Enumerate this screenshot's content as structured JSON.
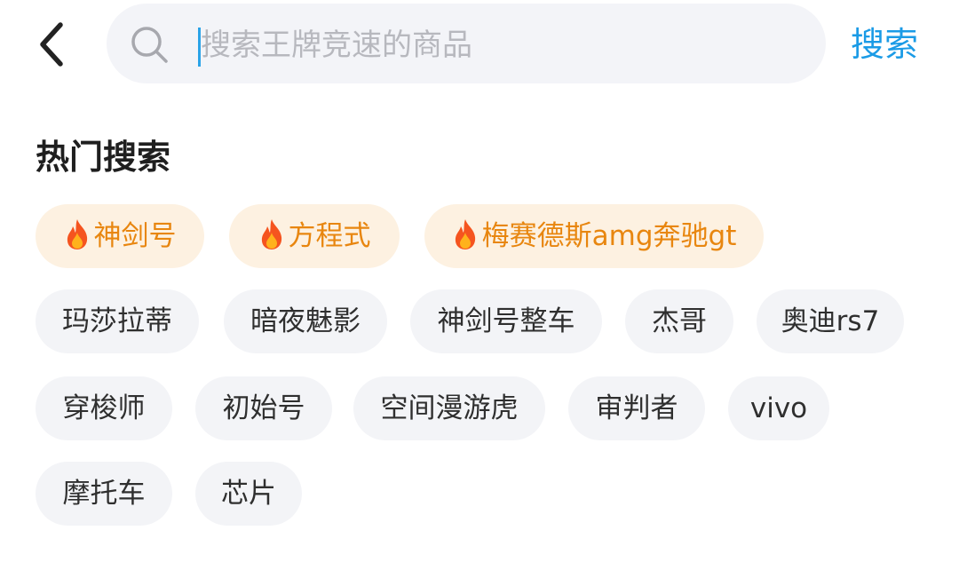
{
  "header": {
    "search_placeholder": "搜索王牌竞速的商品",
    "search_button_label": "搜索"
  },
  "hot_search": {
    "title": "热门搜索",
    "highlight_color": "#e8860f",
    "tags": [
      {
        "label": "神剑号",
        "hot": true
      },
      {
        "label": "方程式",
        "hot": true
      },
      {
        "label": "梅赛德斯amg奔驰gt",
        "hot": true
      },
      {
        "label": "玛莎拉蒂",
        "hot": false
      },
      {
        "label": "暗夜魅影",
        "hot": false
      },
      {
        "label": "神剑号整车",
        "hot": false
      },
      {
        "label": "杰哥",
        "hot": false
      },
      {
        "label": "奥迪rs7",
        "hot": false
      },
      {
        "label": "穿梭师",
        "hot": false
      },
      {
        "label": "初始号",
        "hot": false
      },
      {
        "label": "空间漫游虎",
        "hot": false
      },
      {
        "label": "审判者",
        "hot": false
      },
      {
        "label": "vivo",
        "hot": false
      },
      {
        "label": "摩托车",
        "hot": false
      },
      {
        "label": "芯片",
        "hot": false
      }
    ]
  },
  "icons": {
    "back": "chevron-left-icon",
    "search": "search-icon",
    "hot": "flame-icon"
  }
}
